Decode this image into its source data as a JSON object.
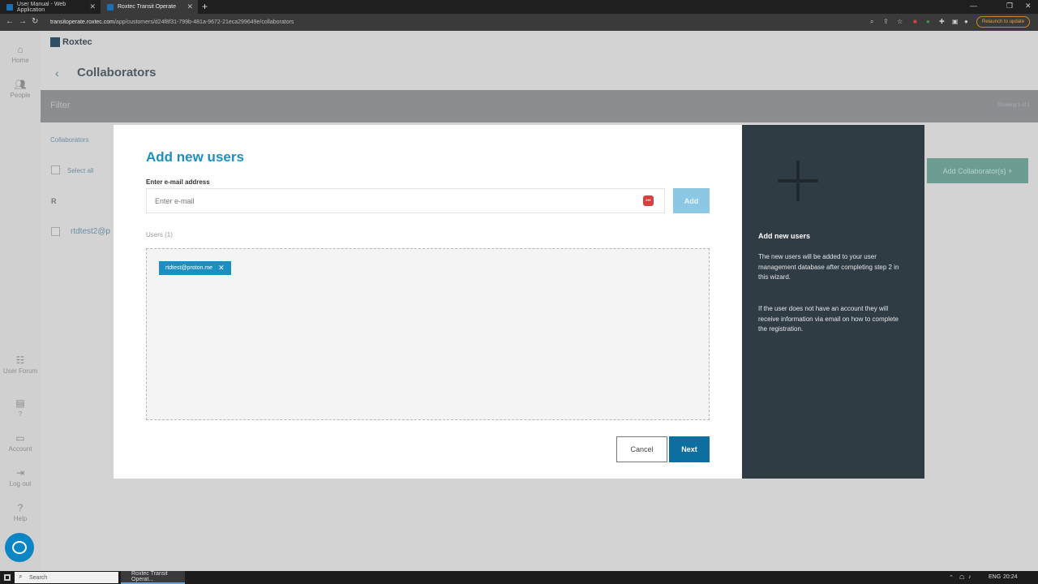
{
  "browser": {
    "tabs": [
      {
        "title": "User Manual - Web Application"
      },
      {
        "title": "Roxtec Transit Operate"
      }
    ],
    "url_host": "transitoperate.roxtec.com",
    "url_path": "/app/customers/d24f8f31-799b-481a-9672-21eca299649e/collaborators",
    "relaunch_label": "Relaunch to update"
  },
  "sidebar": {
    "items": [
      {
        "label": "Home"
      },
      {
        "label": "People"
      },
      {
        "label": "User Forum"
      },
      {
        "label": "?"
      },
      {
        "label": "Account"
      },
      {
        "label": "Log out"
      },
      {
        "label": "Help"
      }
    ]
  },
  "app": {
    "brand": "Roxtec",
    "page_title": "Collaborators",
    "filter_label": "Filter",
    "showing": "Showing 1 of 1",
    "collaborators_tab": "Collaborators",
    "select_all": "Select all",
    "group_letter": "R",
    "row_email": "rtdtest2@p",
    "add_collaborators": "Add Collaborator(s)  +"
  },
  "modal": {
    "title": "Add new users",
    "email_label": "Enter e-mail address",
    "email_placeholder": "Enter e-mail",
    "add_label": "Add",
    "users_count": "Users (1)",
    "chips": [
      {
        "email": "rtdtest@proton.me"
      }
    ],
    "cancel_label": "Cancel",
    "next_label": "Next"
  },
  "panel": {
    "title": "Add new users",
    "p1": "The new users will be added to your user management database after completing step 2 in this wizard.",
    "p2": "If the user does not have an account they will receive information via email on how to complete the registration."
  },
  "taskbar": {
    "search_label": "Search",
    "app_label": "Roxtec Transit Operat...",
    "lang": "ENG",
    "time": "20:24"
  },
  "colors": {
    "accent": "#1b8fc3",
    "next_button": "#0c6fa0",
    "panel": "#2f3c43"
  }
}
